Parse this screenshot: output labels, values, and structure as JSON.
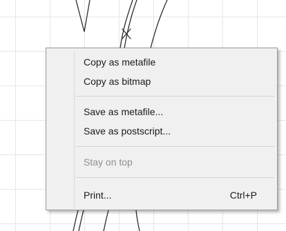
{
  "context_menu": {
    "items": [
      {
        "label": "Copy as metafile",
        "enabled": true
      },
      {
        "label": "Copy as bitmap",
        "enabled": true
      },
      {
        "label": "Save as metafile...",
        "enabled": true
      },
      {
        "label": "Save as postscript...",
        "enabled": true
      },
      {
        "label": "Stay on top",
        "enabled": false
      },
      {
        "label": "Print...",
        "shortcut": "Ctrl+P",
        "enabled": true
      }
    ]
  },
  "colors": {
    "menu_background": "#f0f0f0",
    "menu_border": "#979797",
    "disabled_text": "#8e8e8e",
    "grid": "#e6e6e6"
  }
}
